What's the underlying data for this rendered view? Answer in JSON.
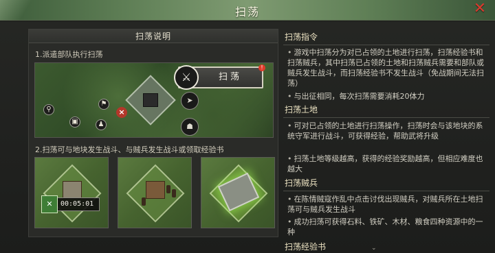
{
  "window": {
    "title": "扫荡",
    "close_icon": "close-icon"
  },
  "guide": {
    "header": "扫荡说明",
    "step1": "1.派遣部队执行扫荡",
    "step2": "2.扫荡可与地块发生战斗、与贼兵发生战斗或领取经验书",
    "popup_label": "扫荡",
    "timer": "00:05:01"
  },
  "sections": [
    {
      "title": "扫荡指令",
      "paras": [
        "游戏中扫荡分为对已占领的土地进行扫荡，扫荡经验书和扫荡贼兵，其中扫荡已占领的土地和扫荡贼兵需要和部队或贼兵发生战斗，而扫荡经验书不发生战斗（免战期间无法扫荡）",
        "与出征相同，每次扫荡需要消耗20体力"
      ]
    },
    {
      "title": "扫荡土地",
      "paras": [
        "可对已占领的土地进行扫荡操作，扫荡时会与该地块的系统守军进行战斗，可获得经验，帮助武将升级",
        "扫荡土地等级越高，获得的经验奖励越高，但相应难度也越大"
      ]
    },
    {
      "title": "扫荡贼兵",
      "paras": [
        "在陈情贼寇作乱中点击讨伐出现贼兵，对贼兵所在土地扫荡可与贼兵发生战斗",
        "成功扫荡可获得石料、铁矿、木材、粮食四种资源中的一种"
      ]
    },
    {
      "title": "扫荡经验书",
      "paras": []
    }
  ],
  "colors": {
    "close": "#d93a2e",
    "title_bar": "#5e7e55",
    "section_title": "#ece3c2"
  }
}
